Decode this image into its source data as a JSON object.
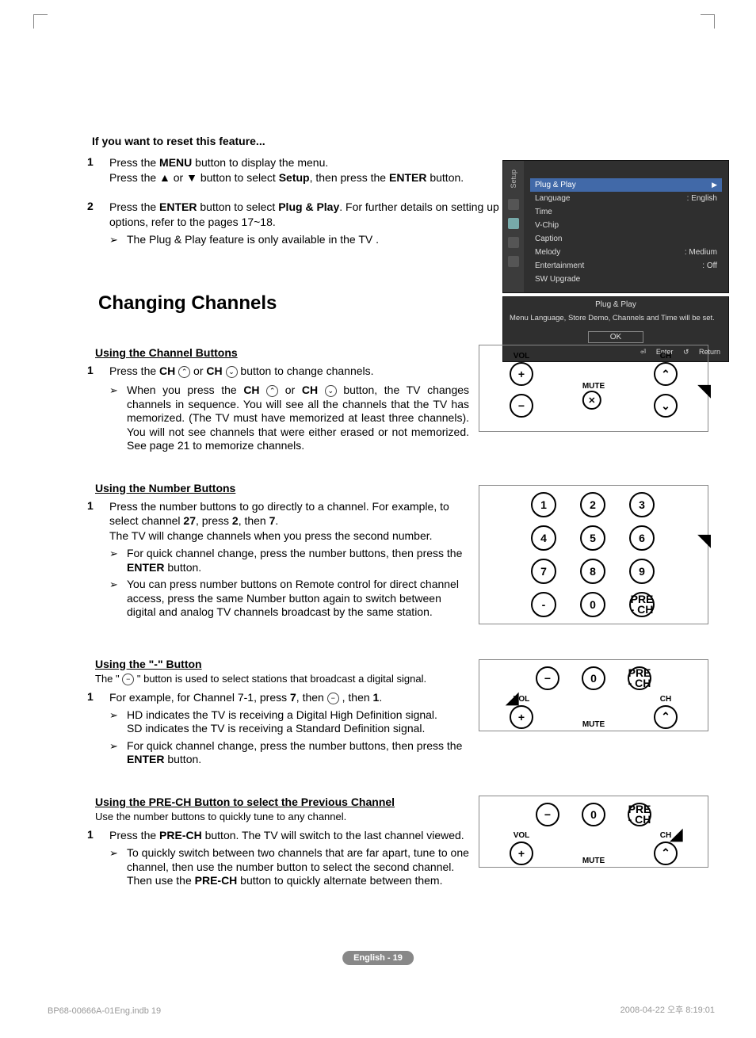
{
  "reset_title": "If you want to reset this feature...",
  "step1": {
    "num": "1",
    "line1_a": "Press the ",
    "line1_b": "MENU",
    "line1_c": " button to display the menu.",
    "line2_a": "Press the ▲ or ▼ button to select ",
    "line2_b": "Setup",
    "line2_c": ", then press the ",
    "line2_d": "ENTER",
    "line2_e": " button."
  },
  "step2": {
    "num": "2",
    "line1_a": "Press the ",
    "line1_b": "ENTER",
    "line1_c": " button to select ",
    "line1_d": "Plug & Play",
    "line1_e": ". For further details on setting up options, refer to the pages 17~18.",
    "note": "The Plug & Play feature is only available in the TV ."
  },
  "osd": {
    "setup_label": "Setup",
    "selected": "Plug & Play",
    "items": [
      {
        "label": "Language",
        "value": ": English"
      },
      {
        "label": "Time",
        "value": ""
      },
      {
        "label": "V-Chip",
        "value": ""
      },
      {
        "label": "Caption",
        "value": ""
      },
      {
        "label": "Melody",
        "value": ": Medium"
      },
      {
        "label": "Entertainment",
        "value": ": Off"
      },
      {
        "label": "SW Upgrade",
        "value": ""
      }
    ],
    "dialog_title": "Plug & Play",
    "dialog_msg": "Menu Language, Store Demo, Channels and Time will be set.",
    "ok": "OK",
    "enter": "Enter",
    "return": "Return"
  },
  "section_title": "Changing Channels",
  "chbtn": {
    "title": "Using the Channel Buttons",
    "num": "1",
    "l1a": "Press the ",
    "l1b": "CH",
    "l1c": " or ",
    "l1d": "CH",
    "l1e": "button to change channels.",
    "note_a": "When you press the ",
    "note_b": "CH",
    "note_c": " or ",
    "note_d": "CH",
    "note_e": " button, the TV changes channels in sequence. You will see all the channels that the TV has memorized. (The TV must have memorized at least three channels). You will not see channels that were either erased or not memorized. See page 21 to memorize channels."
  },
  "numbtn": {
    "title": "Using the Number Buttons",
    "num": "1",
    "l1a": "Press the number buttons to go directly to a channel. For example, to select channel ",
    "l1b": "27",
    "l1c": ", press ",
    "l1d": "2",
    "l1e": ", then ",
    "l1f": "7",
    "l1g": ".",
    "l2": "The TV will change channels when you press the second number.",
    "note1a": "For quick channel change, press the number buttons, then press the ",
    "note1b": "ENTER",
    "note1c": " button.",
    "note2": "You can press number buttons on Remote control for direct channel access, press the same Number button again to switch between digital and analog TV channels broadcast by the same station."
  },
  "dashbtn": {
    "title": "Using the \"-\" Button",
    "intro": "The \"      \" button is used to select stations that broadcast a digital signal.",
    "num": "1",
    "l1a": "For example, for Channel 7-1, press ",
    "l1b": "7",
    "l1c": ", then ",
    "l1d": " , then ",
    "l1e": "1",
    "l1f": ".",
    "note1": "HD indicates the TV is receiving a Digital High Definition signal.\nSD indicates the TV is receiving a Standard Definition signal.",
    "note2a": "For quick channel change, press the number buttons, then press the ",
    "note2b": "ENTER",
    "note2c": " button."
  },
  "prech": {
    "title": "Using the PRE-CH Button to select the Previous Channel",
    "intro": "Use the number buttons to quickly tune to any channel.",
    "num": "1",
    "l1a": "Press the ",
    "l1b": "PRE-CH",
    "l1c": " button. The TV will switch to the last channel viewed.",
    "note_a": "To quickly switch between two channels that are far apart, tune to one channel, then use the number button to select the second channel. Then use the ",
    "note_b": "PRE-CH",
    "note_c": " button to quickly alternate between them."
  },
  "remote": {
    "vol": "VOL",
    "ch": "CH",
    "mute": "MUTE",
    "prech": "PRE\n- CH",
    "nums": [
      "1",
      "2",
      "3",
      "4",
      "5",
      "6",
      "7",
      "8",
      "9",
      "-",
      "0"
    ]
  },
  "page_tag": "English - 19",
  "footer_left": "BP68-00666A-01Eng.indb   19",
  "footer_right": "2008-04-22   오후 8:19:01"
}
